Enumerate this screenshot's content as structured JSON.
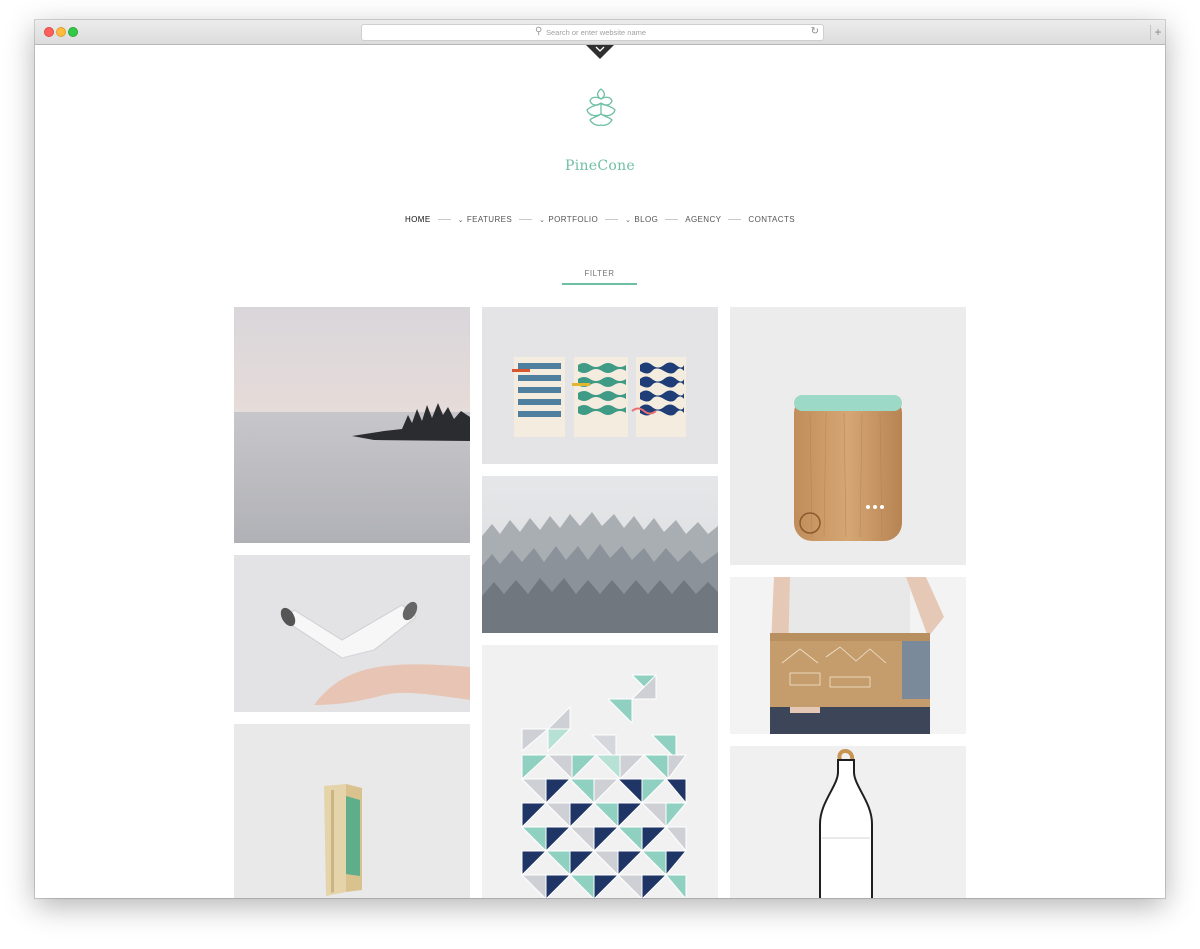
{
  "browser": {
    "url_placeholder": "Search or enter website name",
    "search_glyph": "⚲",
    "reload_glyph": "↻",
    "new_tab_glyph": "+"
  },
  "site": {
    "brand": "PineCone",
    "accent_color": "#6fbfa6",
    "logo_icon": "pinecone-icon"
  },
  "nav": {
    "items": [
      {
        "label": "HOME",
        "active": true,
        "dropdown": false
      },
      {
        "label": "FEATURES",
        "active": false,
        "dropdown": true
      },
      {
        "label": "PORTFOLIO",
        "active": false,
        "dropdown": true
      },
      {
        "label": "BLOG",
        "active": false,
        "dropdown": true
      },
      {
        "label": "AGENCY",
        "active": false,
        "dropdown": false
      },
      {
        "label": "CONTACTS",
        "active": false,
        "dropdown": false
      }
    ],
    "dropdown_glyph": "⌄"
  },
  "filter": {
    "label": "FILTER"
  },
  "portfolio": {
    "columns": [
      [
        "lake-landscape",
        "white-pipe-object",
        "wood-green-book"
      ],
      [
        "wave-cards",
        "snowy-forest",
        "triangle-tiles"
      ],
      [
        "wooden-device",
        "box-held",
        "white-bottle"
      ]
    ]
  }
}
